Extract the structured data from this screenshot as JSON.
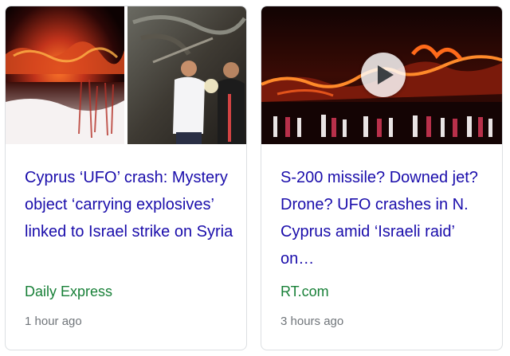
{
  "cards": [
    {
      "headline": "Cyprus ‘UFO’ crash: Mystery object ‘carrying explosives’ linked to Israel strike on Syria",
      "source": "Daily Express",
      "time": "1 hour ago",
      "thumbnail_description": "fire-at-night-and-men-at-crash-site"
    },
    {
      "headline": "S-200 missile? Downed jet? Drone? UFO crashes in N. Cyprus amid ‘Israeli raid’ on…",
      "source": "RT.com",
      "time": "3 hours ago",
      "has_video": true,
      "play_icon": "play-icon"
    }
  ],
  "colors": {
    "headline": "#1a0dab",
    "source": "#188038",
    "time": "#70757a",
    "border": "#dcdfe2"
  }
}
